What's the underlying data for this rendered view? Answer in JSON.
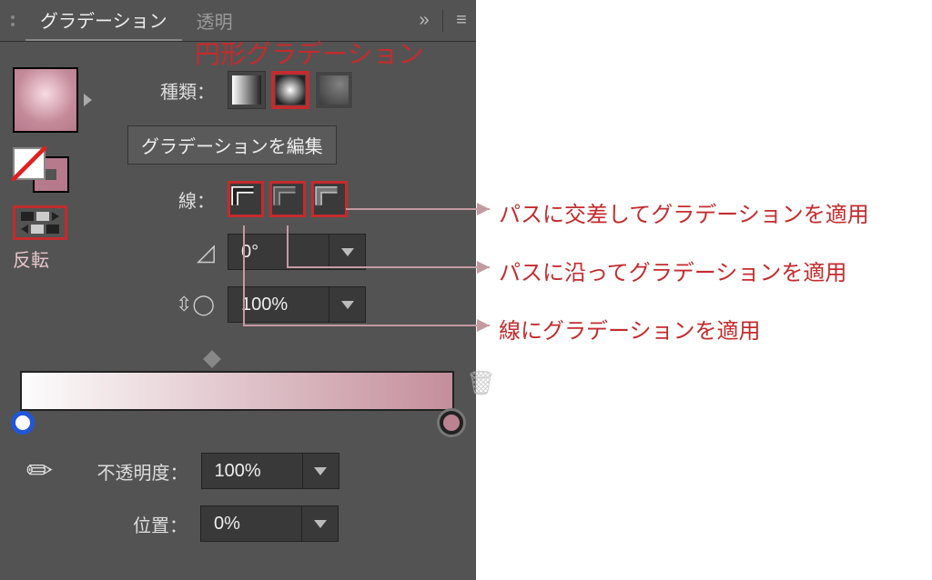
{
  "tabs": {
    "gradient": "グラデーション",
    "transparency": "透明"
  },
  "callouts": {
    "title": "円形グラデーション",
    "reverse": "反転",
    "line1": "パスに交差してグラデーションを適用",
    "line2": "パスに沿ってグラデーションを適用",
    "line3": "線にグラデーションを適用"
  },
  "labels": {
    "type": "種類：",
    "edit": "グラデーションを編集",
    "line": "線：",
    "opacity": "不透明度：",
    "position": "位置："
  },
  "values": {
    "angle": "0°",
    "aspect": "100%",
    "opacity": "100%",
    "position": "0%"
  }
}
